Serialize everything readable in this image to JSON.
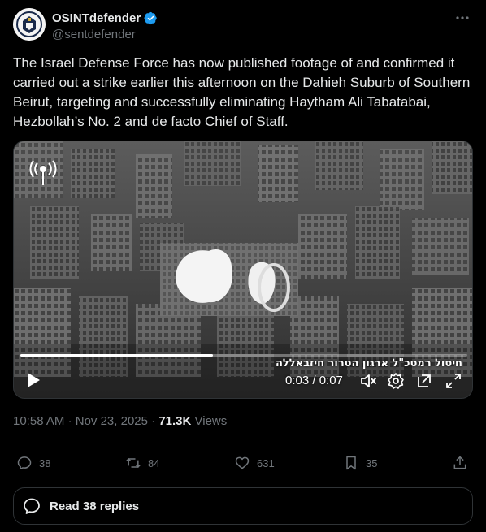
{
  "author": {
    "display_name": "OSINTdefender",
    "handle": "@sentdefender",
    "verified": true
  },
  "tweet": {
    "text": "The Israel Defense Force has now published footage of and confirmed it carried out a strike earlier this afternoon on the Dahieh Suburb of Southern Beirut, targeting and successfully eliminating Haytham Ali Tabatabai, Hezbollah’s No. 2 and de facto Chief of Staff."
  },
  "video": {
    "caption": "חיסול רמטכ\"ל ארגון הטרור חיזבאללה",
    "time": "0:03 / 0:07",
    "progress": 0.43
  },
  "meta": {
    "time": "10:58 AM",
    "separator": "·",
    "date": "Nov 23, 2025",
    "views_count": "71.3K",
    "views_label": "Views"
  },
  "actions": {
    "replies": "38",
    "reposts": "84",
    "likes": "631",
    "bookmarks": "35"
  },
  "read_replies": {
    "label": "Read 38 replies"
  },
  "colors": {
    "background": "#000000",
    "text": "#e7e9ea",
    "muted": "#71767b",
    "border": "#2f3336",
    "verified": "#1d9bf0"
  },
  "icons": [
    "avatar-logo",
    "verified-badge-icon",
    "more-icon",
    "idf-logo-icon",
    "play-icon",
    "mute-icon",
    "settings-icon",
    "expand-icon",
    "fullscreen-icon",
    "reply-icon",
    "repost-icon",
    "like-icon",
    "bookmark-icon",
    "share-icon",
    "replies-bubble-icon"
  ]
}
